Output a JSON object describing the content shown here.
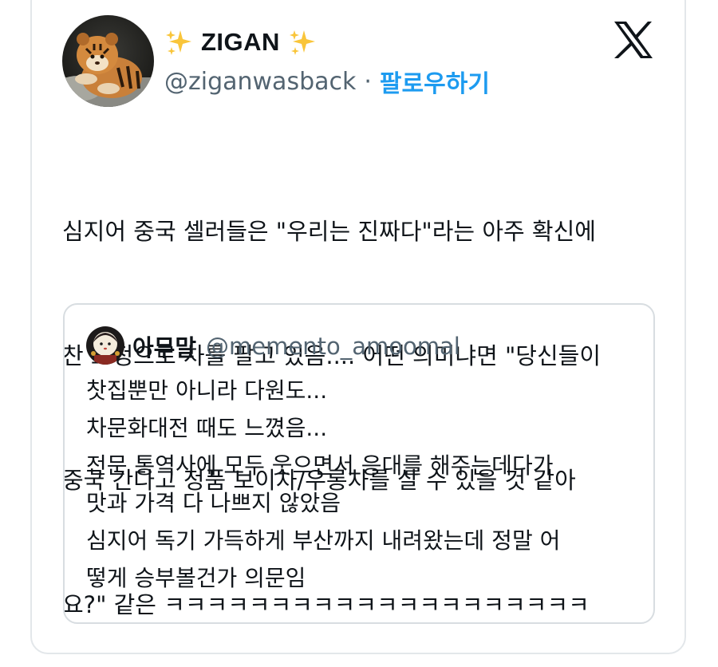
{
  "tweet": {
    "author": {
      "display_name": "ZIGAN",
      "handle": "@ziganwasback",
      "separator": "·",
      "follow_label": "팔로우하기",
      "name_emoji_icon": "sparkles-icon"
    },
    "text": "심지어 중국 셀러들은 \"우리는 진짜다\"라는 아주 확신에 찬 표정으로 차를 팔고 있음.... 어떤 의미냐면 \"당신들이 중국 간다고 정품 보이차/우롱차를 살 수 있을 것 같아요?\" 같은 ㅋㅋㅋㅋㅋㅋㅋㅋㅋㅋㅋㅋㅋㅋㅋㅋㅋㅋㅋㅋ",
    "text_lines": [
      "심지어 중국 셀러들은 \"우리는 진짜다\"라는 아주 확신에",
      "찬 표정으로 차를 팔고 있음.... 어떤 의미냐면 \"당신들이",
      "중국 간다고 정품 보이차/우롱차를 살 수 있을 것 같아",
      "요?\" 같은 ㅋㅋㅋㅋㅋㅋㅋㅋㅋㅋㅋㅋㅋㅋㅋㅋㅋㅋㅋㅋ"
    ]
  },
  "quoted_tweet": {
    "display_name": "아무말",
    "handle": "@memento_amoomal",
    "lines": [
      "찻집뿐만 아니라 다원도...",
      "차문화대전 때도 느꼈음...",
      "전문 통역사에 모두 웃으면서 응대를 해주는데다가",
      "맛과 가격 다 나쁘지 않았음",
      "심지어 독기 가득하게 부산까지 내려왔는데 정말 어",
      "떻게 승부볼건가 의문임"
    ]
  },
  "colors": {
    "accent": "#1d9bf0",
    "secondary_text": "#536471",
    "primary_text": "#0f1419",
    "border": "#e3e7ea"
  },
  "icons": {
    "brand": "x-logo-icon",
    "avatar": "tiger-cub-avatar",
    "quoted_avatar": "doll-avatar"
  }
}
